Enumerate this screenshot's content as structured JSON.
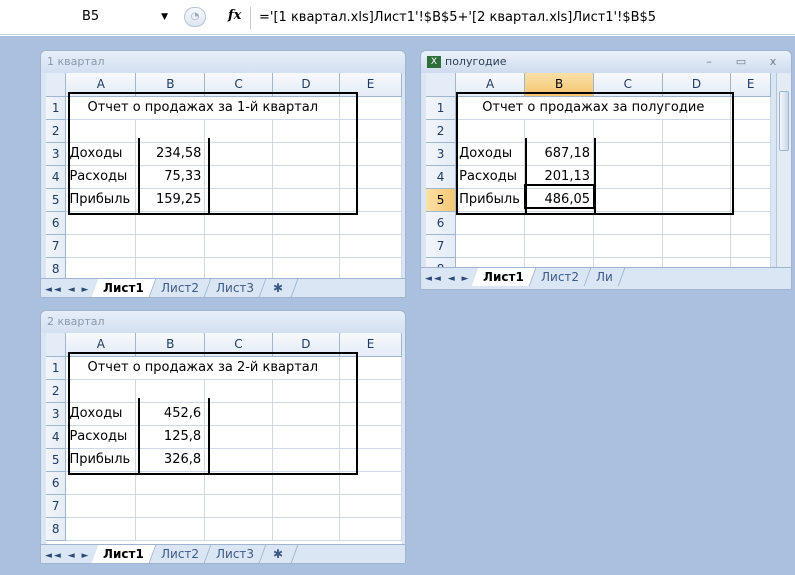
{
  "formula_bar": {
    "name_box": "B5",
    "fx_label": "fx",
    "formula": "='[1 квартал.xls]Лист1'!$B$5+'[2 квартал.xls]Лист1'!$B$5"
  },
  "columns": [
    "A",
    "B",
    "C",
    "D",
    "E"
  ],
  "rows": [
    "1",
    "2",
    "3",
    "4",
    "5",
    "6",
    "7",
    "8"
  ],
  "tabs": {
    "nav": "◄◄ ◄ ► ►►",
    "sheet1": "Лист1",
    "sheet2": "Лист2",
    "sheet3": "Лист3",
    "sheet3_partial": "Ли",
    "new_sheet": "✱"
  },
  "window_q1": {
    "title": "1 квартал",
    "heading": "Отчет о продажах за 1-й квартал",
    "rows": [
      {
        "label": "Доходы",
        "value": "234,58"
      },
      {
        "label": "Расходы",
        "value": "75,33"
      },
      {
        "label": "Прибыль",
        "value": "159,25"
      }
    ]
  },
  "window_half": {
    "title": "полугодие",
    "heading": "Отчет о продажах за полугодие",
    "rows": [
      {
        "label": "Доходы",
        "value": "687,18"
      },
      {
        "label": "Расходы",
        "value": "201,13"
      },
      {
        "label": "Прибыль",
        "value": "486,05"
      }
    ],
    "buttons": {
      "minimize": "–",
      "restore": "▭",
      "close": "x"
    }
  },
  "window_q2": {
    "title": "2 квартал",
    "heading": "Отчет о продажах за 2-й квартал",
    "rows": [
      {
        "label": "Доходы",
        "value": "452,6"
      },
      {
        "label": "Расходы",
        "value": "125,8"
      },
      {
        "label": "Прибыль",
        "value": "326,8"
      }
    ]
  }
}
